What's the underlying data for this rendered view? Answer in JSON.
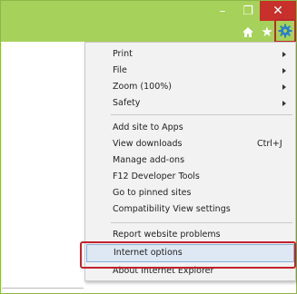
{
  "titlebar": {
    "min_glyph": "–",
    "max_glyph": "❐",
    "close_glyph": "✕"
  },
  "toolbar": {
    "favorites_glyph": "★",
    "icons": [
      "home-icon",
      "favorites-icon",
      "gear-icon"
    ]
  },
  "menu": {
    "items": [
      {
        "label": "Print",
        "submenu": true
      },
      {
        "label": "File",
        "submenu": true
      },
      {
        "label": "Zoom (100%)",
        "submenu": true
      },
      {
        "label": "Safety",
        "submenu": true
      },
      {
        "label": "Add site to Apps"
      },
      {
        "label": "View downloads",
        "shortcut": "Ctrl+J"
      },
      {
        "label": "Manage add-ons"
      },
      {
        "label": "F12 Developer Tools"
      },
      {
        "label": "Go to pinned sites"
      },
      {
        "label": "Compatibility View settings"
      },
      {
        "label": "Report website problems"
      },
      {
        "label": "Internet options",
        "highlighted": true
      },
      {
        "label": "About Internet Explorer"
      }
    ]
  },
  "colors": {
    "titlebar": "#a6d15a",
    "close_button": "#c7302b",
    "highlight_outline": "#c2222c",
    "menu_background": "#f2f2f2",
    "hover_background": "#dde8f4"
  }
}
